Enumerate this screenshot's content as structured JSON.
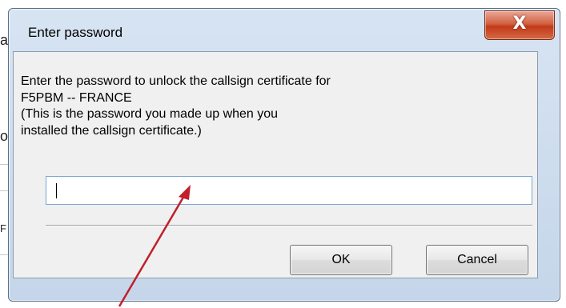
{
  "dialog": {
    "title": "Enter password",
    "close_glyph": "X",
    "message_lines": [
      "Enter the password to unlock the callsign certificate for",
      "F5PBM -- FRANCE",
      "(This is the password you made up when you",
      "installed the callsign certificate.)"
    ],
    "password_value": "",
    "ok_label": "OK",
    "cancel_label": "Cancel"
  },
  "background": {
    "glyphs": [
      "a",
      "o",
      "F"
    ]
  },
  "colors": {
    "annotation_arrow": "#c0202a",
    "close_button": "#c8482a"
  },
  "icons": {
    "close": "close-icon"
  }
}
